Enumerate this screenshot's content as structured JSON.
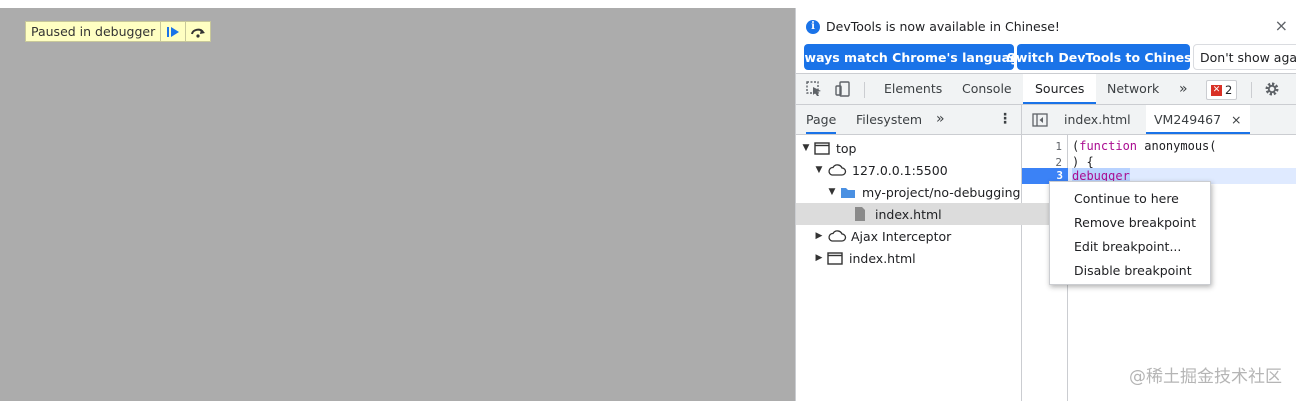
{
  "page": {
    "paused_label": "Paused in debugger"
  },
  "devtools": {
    "infobar": {
      "message": "DevTools is now available in Chinese!",
      "btn_match": "Always match Chrome's language",
      "btn_switch": "Switch DevTools to Chinese",
      "btn_dont_show": "Don't show agai"
    },
    "toolbar": {
      "tabs": [
        "Elements",
        "Console",
        "Sources",
        "Network"
      ],
      "active_tab": "Sources",
      "error_count": "2"
    },
    "navigator": {
      "tabs": [
        "Page",
        "Filesystem"
      ],
      "tree": [
        "top",
        "127.0.0.1:5500",
        "my-project/no-debugging",
        "index.html",
        "Ajax Interceptor",
        "index.html"
      ]
    },
    "editor": {
      "tabs": [
        "index.html",
        "VM249467"
      ],
      "close_glyph": "×",
      "line_numbers": [
        "1",
        "2",
        "3"
      ],
      "code": {
        "l1_kw": "function",
        "l1_paren": "(",
        "l1_rest": " anonymous(",
        "l2": ") {",
        "l3": "debugger"
      }
    },
    "context_menu": [
      "Continue to here",
      "Remove breakpoint",
      "Edit breakpoint...",
      "Disable breakpoint"
    ]
  },
  "watermark": "@稀土掘金技术社区",
  "colors": {
    "accent": "#1a73e8",
    "paused_bg": "#ffffc2",
    "page_bg": "#acacac",
    "keyword": "#aa0d91",
    "error": "#d93025"
  }
}
